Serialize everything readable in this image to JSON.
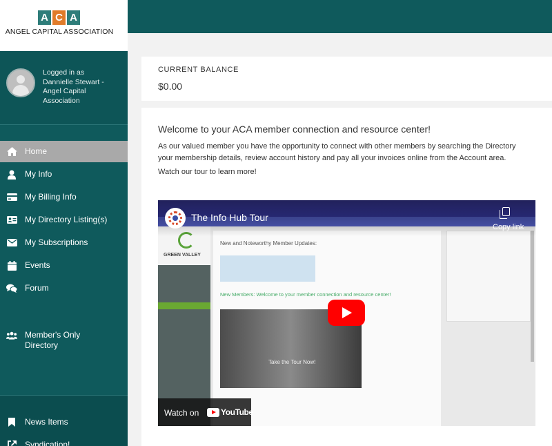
{
  "logo": {
    "letters": [
      "A",
      "C",
      "A"
    ],
    "letter_colors": [
      "#2e7d7a",
      "#e07b2a",
      "#2e7d7a"
    ],
    "org_name": "ANGEL CAPITAL ASSOCIATION"
  },
  "user": {
    "status_line": "Logged in as",
    "name_line": "Dannielle Stewart - Angel Capital Association"
  },
  "nav": {
    "items": [
      {
        "label": "Home",
        "icon": "home-icon",
        "active": true
      },
      {
        "label": "My Info",
        "icon": "user-icon",
        "active": false
      },
      {
        "label": "My Billing Info",
        "icon": "credit-card-icon",
        "active": false
      },
      {
        "label": "My Directory Listing(s)",
        "icon": "id-card-icon",
        "active": false
      },
      {
        "label": "My Subscriptions",
        "icon": "envelope-icon",
        "active": false
      },
      {
        "label": "Events",
        "icon": "calendar-icon",
        "active": false
      },
      {
        "label": "Forum",
        "icon": "comments-icon",
        "active": false
      },
      {
        "label": "Member's Only Directory",
        "icon": "users-icon",
        "active": false
      },
      {
        "label": "News Items",
        "icon": "bookmark-icon",
        "active": false
      },
      {
        "label": "Syndication!",
        "icon": "external-link-icon",
        "active": false
      }
    ]
  },
  "balance": {
    "label": "CURRENT BALANCE",
    "value": "$0.00"
  },
  "main": {
    "welcome": "Welcome to your ACA member connection and resource center!",
    "paragraph_line1": "As our valued member you have the opportunity to connect with other members by searching the Directory",
    "paragraph_line2": "your membership details, review account history and pay all your invoices online from the Account area.",
    "watch_text": "Watch our tour to learn more!"
  },
  "video": {
    "title": "The Info Hub Tour",
    "copy_label": "Copy link",
    "watch_on": "Watch on",
    "youtube_word": "YouTube",
    "inner_logo": "GREEN VALLEY",
    "inner_heading1": "New and Noteworthy Member Updates:",
    "inner_heading2": "New Members: Welcome to your member connection and resource center!",
    "inner_tour": "Take the Tour Now!"
  },
  "colors": {
    "sidebar": "#0f5a5c",
    "topbar": "#0f5a5c",
    "active_nav": "#a9a9a9"
  }
}
